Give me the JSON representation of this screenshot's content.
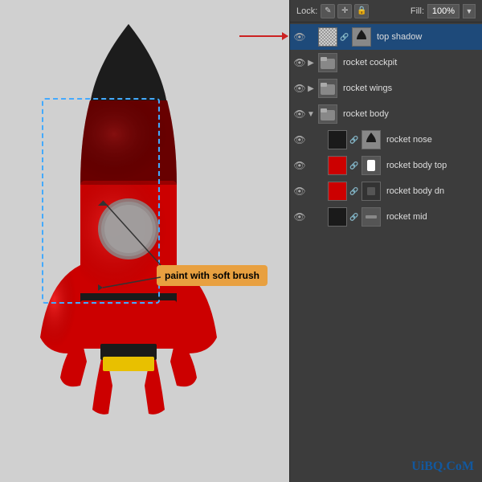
{
  "panel": {
    "lock_label": "Lock:",
    "fill_label": "Fill:",
    "fill_value": "100%",
    "lock_icons": [
      "✎",
      "✛",
      "🔒"
    ],
    "layers": [
      {
        "id": "top-shadow",
        "name": "top shadow",
        "indent": 0,
        "selected": true,
        "has_arrow": false,
        "thumb1_bg": "#888888",
        "thumb1_content": "checker",
        "thumb2_bg": "#888888",
        "has_link": true
      },
      {
        "id": "rocket-cockpit",
        "name": "rocket cockpit",
        "indent": 0,
        "selected": false,
        "has_arrow": true,
        "arrow_open": false,
        "thumb1_bg": "#555",
        "thumb1_content": "folder",
        "thumb2_bg": null,
        "has_link": false
      },
      {
        "id": "rocket-wings",
        "name": "rocket wings",
        "indent": 0,
        "selected": false,
        "has_arrow": true,
        "arrow_open": false,
        "thumb1_bg": "#555",
        "thumb1_content": "folder",
        "thumb2_bg": null,
        "has_link": false
      },
      {
        "id": "rocket-body",
        "name": "rocket body",
        "indent": 0,
        "selected": false,
        "has_arrow": true,
        "arrow_open": true,
        "thumb1_bg": "#555",
        "thumb1_content": "folder",
        "thumb2_bg": null,
        "has_link": false
      },
      {
        "id": "rocket-nose",
        "name": "rocket nose",
        "indent": 1,
        "selected": false,
        "has_arrow": false,
        "thumb1_bg": "#1a1a1a",
        "thumb1_content": "dark",
        "thumb2_bg": "#888888",
        "has_link": true
      },
      {
        "id": "rocket-body-top",
        "name": "rocket body top",
        "indent": 1,
        "selected": false,
        "has_arrow": false,
        "thumb1_bg": "#cc0000",
        "thumb1_content": "red",
        "thumb2_bg": "#ffffff",
        "has_link": true
      },
      {
        "id": "rocket-body-dn",
        "name": "rocket body dn",
        "indent": 1,
        "selected": false,
        "has_arrow": false,
        "thumb1_bg": "#cc0000",
        "thumb1_content": "red",
        "thumb2_bg": "#333333",
        "has_link": true
      },
      {
        "id": "rocket-mid",
        "name": "rocket mid",
        "indent": 1,
        "selected": false,
        "has_arrow": false,
        "thumb1_bg": "#1a1a1a",
        "thumb1_content": "dark",
        "thumb2_bg": "#555555",
        "has_link": true
      }
    ]
  },
  "annotation": {
    "text": "paint with soft brush"
  },
  "watermark": {
    "text": "UiBQ.CoM"
  }
}
